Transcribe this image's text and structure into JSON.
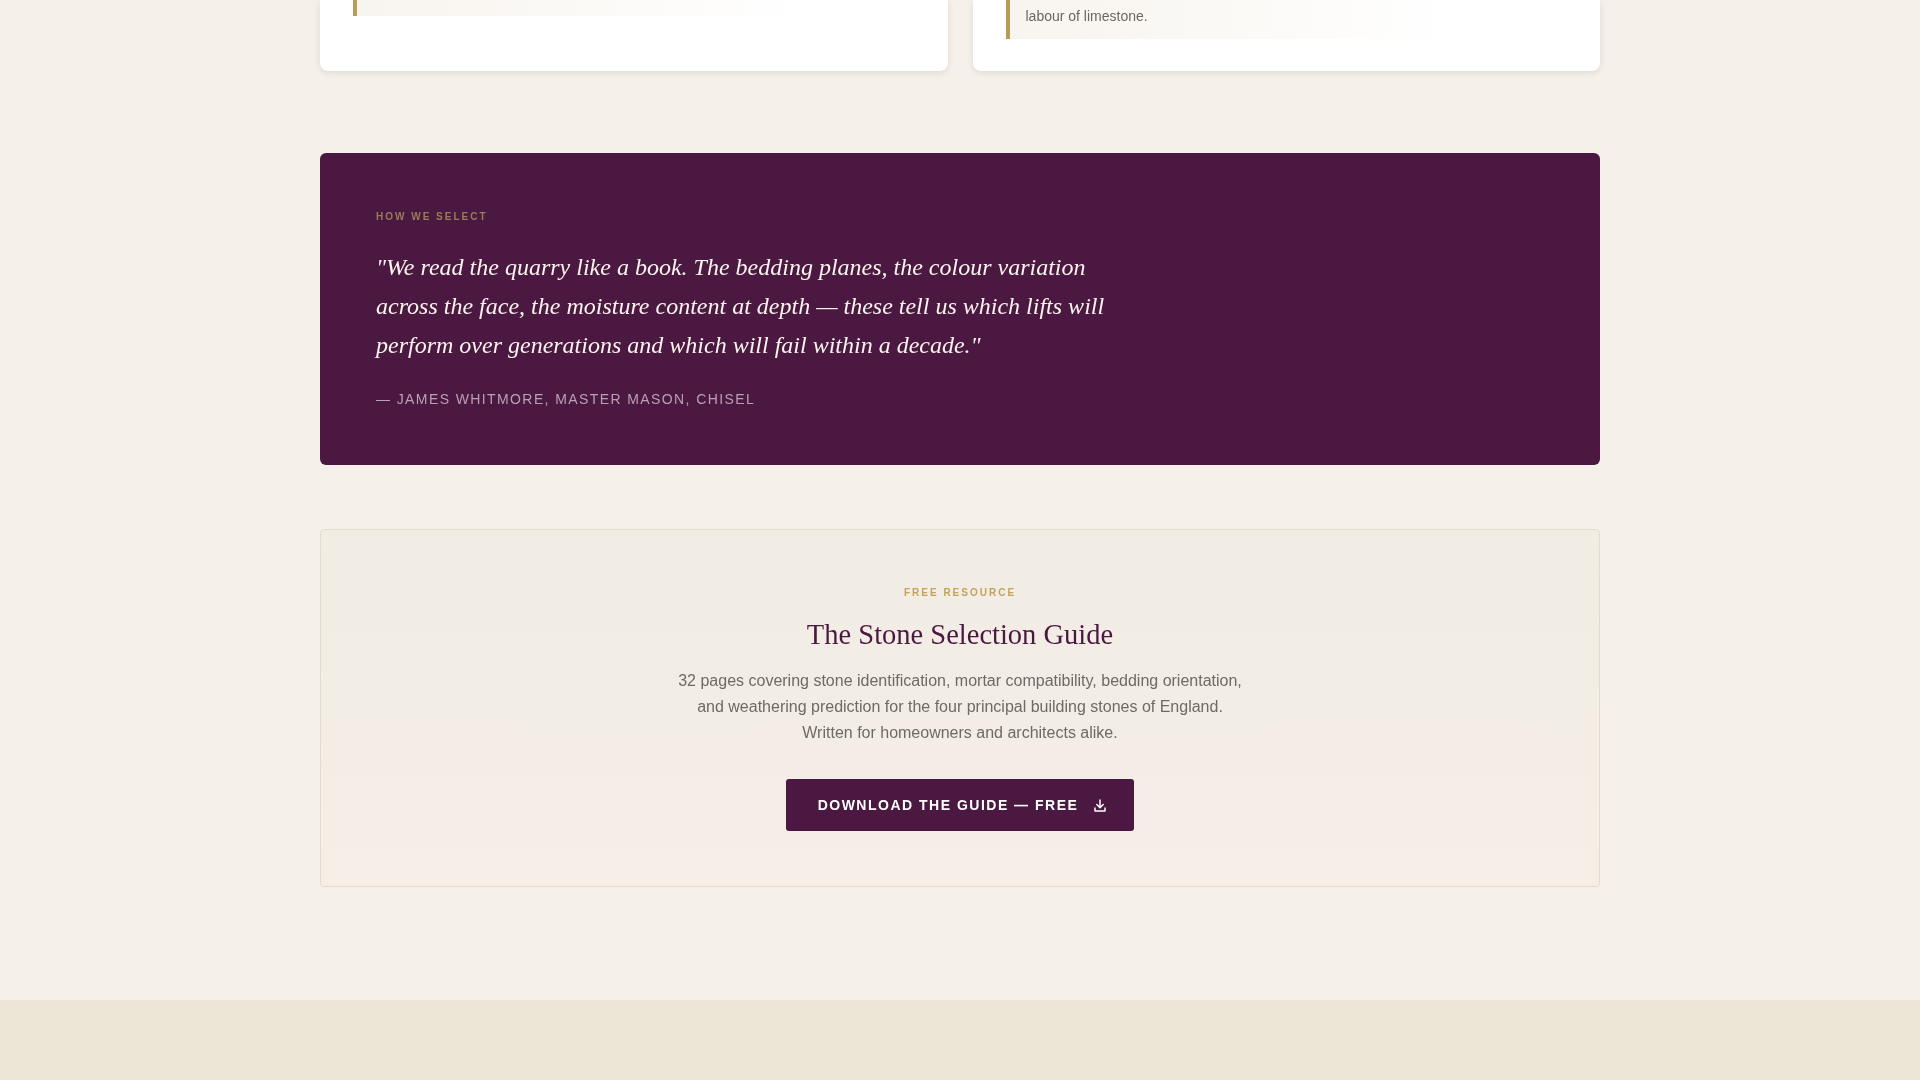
{
  "cards": [
    {
      "quote": "labour of limestone."
    }
  ],
  "feature": {
    "eyebrow": "HOW WE SELECT",
    "quote": "\"We read the quarry like a book. The bedding planes, the colour variation across the face, the moisture content at depth — these tell us which lifts will perform over generations and which will fail within a decade.\"",
    "attribution": "— JAMES WHITMORE, MASTER MASON, CHISEL"
  },
  "resource": {
    "eyebrow": "FREE RESOURCE",
    "title": "The Stone Selection Guide",
    "description": "32 pages covering stone identification, mortar compatibility, bedding orientation, and weathering prediction for the four principal building stones of England. Written for homeowners and architects alike.",
    "button": "DOWNLOAD THE GUIDE — FREE"
  }
}
